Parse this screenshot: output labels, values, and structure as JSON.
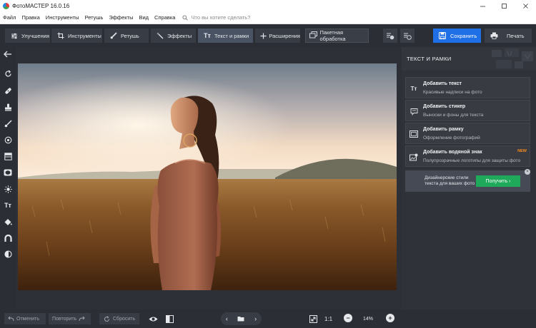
{
  "window": {
    "title": "ФотоМАСТЕР 16.0.16"
  },
  "menu": {
    "items": [
      "Файл",
      "Правка",
      "Инструменты",
      "Ретушь",
      "Эффекты",
      "Вид",
      "Справка"
    ],
    "search_placeholder": "Что вы хотите сделать?"
  },
  "toolbar": {
    "tabs": [
      {
        "label": "Улучшения",
        "icon": "enhance-icon"
      },
      {
        "label": "Инструменты",
        "icon": "crop-icon"
      },
      {
        "label": "Ретушь",
        "icon": "brush-icon"
      },
      {
        "label": "Эффекты",
        "icon": "magic-wand-icon"
      },
      {
        "label": "Текст и рамки",
        "icon": "text-icon",
        "active": true
      },
      {
        "label": "Расширения",
        "icon": "plus-icon"
      }
    ],
    "batch_label": "Пакетная обработка",
    "save_label": "Сохранить",
    "print_label": "Печать"
  },
  "right_panel": {
    "title": "ТЕКСТ И РАМКИ",
    "options": [
      {
        "title": "Добавить текст",
        "desc": "Красивые надписи на фото",
        "icon": "Tт"
      },
      {
        "title": "Добавить стикер",
        "desc": "Выноски и фоны для текста",
        "icon": "sticker"
      },
      {
        "title": "Добавить рамку",
        "desc": "Оформление фотографий",
        "icon": "frame"
      },
      {
        "title": "Добавить водяной знак",
        "desc": "Полупрозрачные логотипы для защиты фото",
        "icon": "watermark",
        "badge": "NEW"
      }
    ],
    "promo": {
      "text": "Дизайнерские стили текста для ваших фото",
      "button": "Получить  ›"
    }
  },
  "bottom": {
    "undo_label": "Отменить",
    "redo_label": "Повторить",
    "reset_label": "Сбросить",
    "ratio_label": "1:1",
    "zoom_label": "14%"
  },
  "colors": {
    "accent": "#1f6fe6",
    "promo_green": "#1eaa5a",
    "new_badge": "#ff8c1a"
  }
}
